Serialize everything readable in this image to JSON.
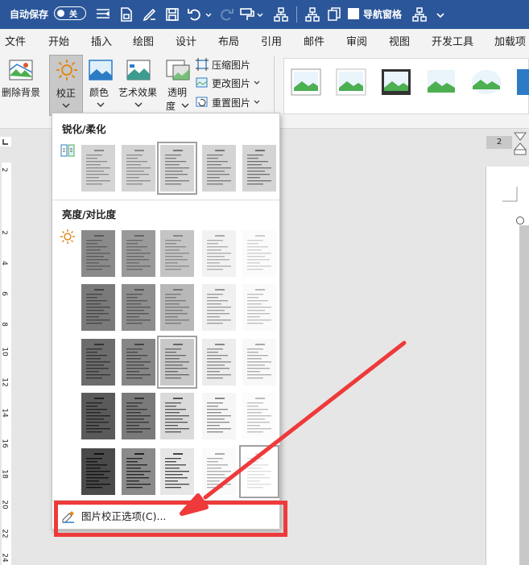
{
  "quick_access": {
    "autosave_label": "自动保存",
    "autosave_state": "关",
    "nav_pane_label": "导航窗格"
  },
  "tabs": [
    "文件",
    "开始",
    "插入",
    "绘图",
    "设计",
    "布局",
    "引用",
    "邮件",
    "审阅",
    "视图",
    "开发工具",
    "加载项"
  ],
  "ribbon": {
    "remove_bg": "删除背景",
    "corrections": "校正",
    "color": "颜色",
    "artistic": "艺术效果",
    "transparency_1": "透明",
    "transparency_2": "度",
    "compress": "压缩图片",
    "change": "更改图片",
    "reset": "重置图片"
  },
  "page_number": "2",
  "ruler_numbers": [
    "2",
    "2",
    "4",
    "6",
    "8",
    "10",
    "12",
    "14",
    "16",
    "18",
    "20",
    "22",
    "24"
  ],
  "dropdown": {
    "sharpen_title": "锐化/柔化",
    "brightness_title": "亮度/对比度",
    "options_label": "图片校正选项(C)..."
  },
  "colors": {
    "titlebar": "#2b579a",
    "highlight": "#ee3a3a"
  }
}
